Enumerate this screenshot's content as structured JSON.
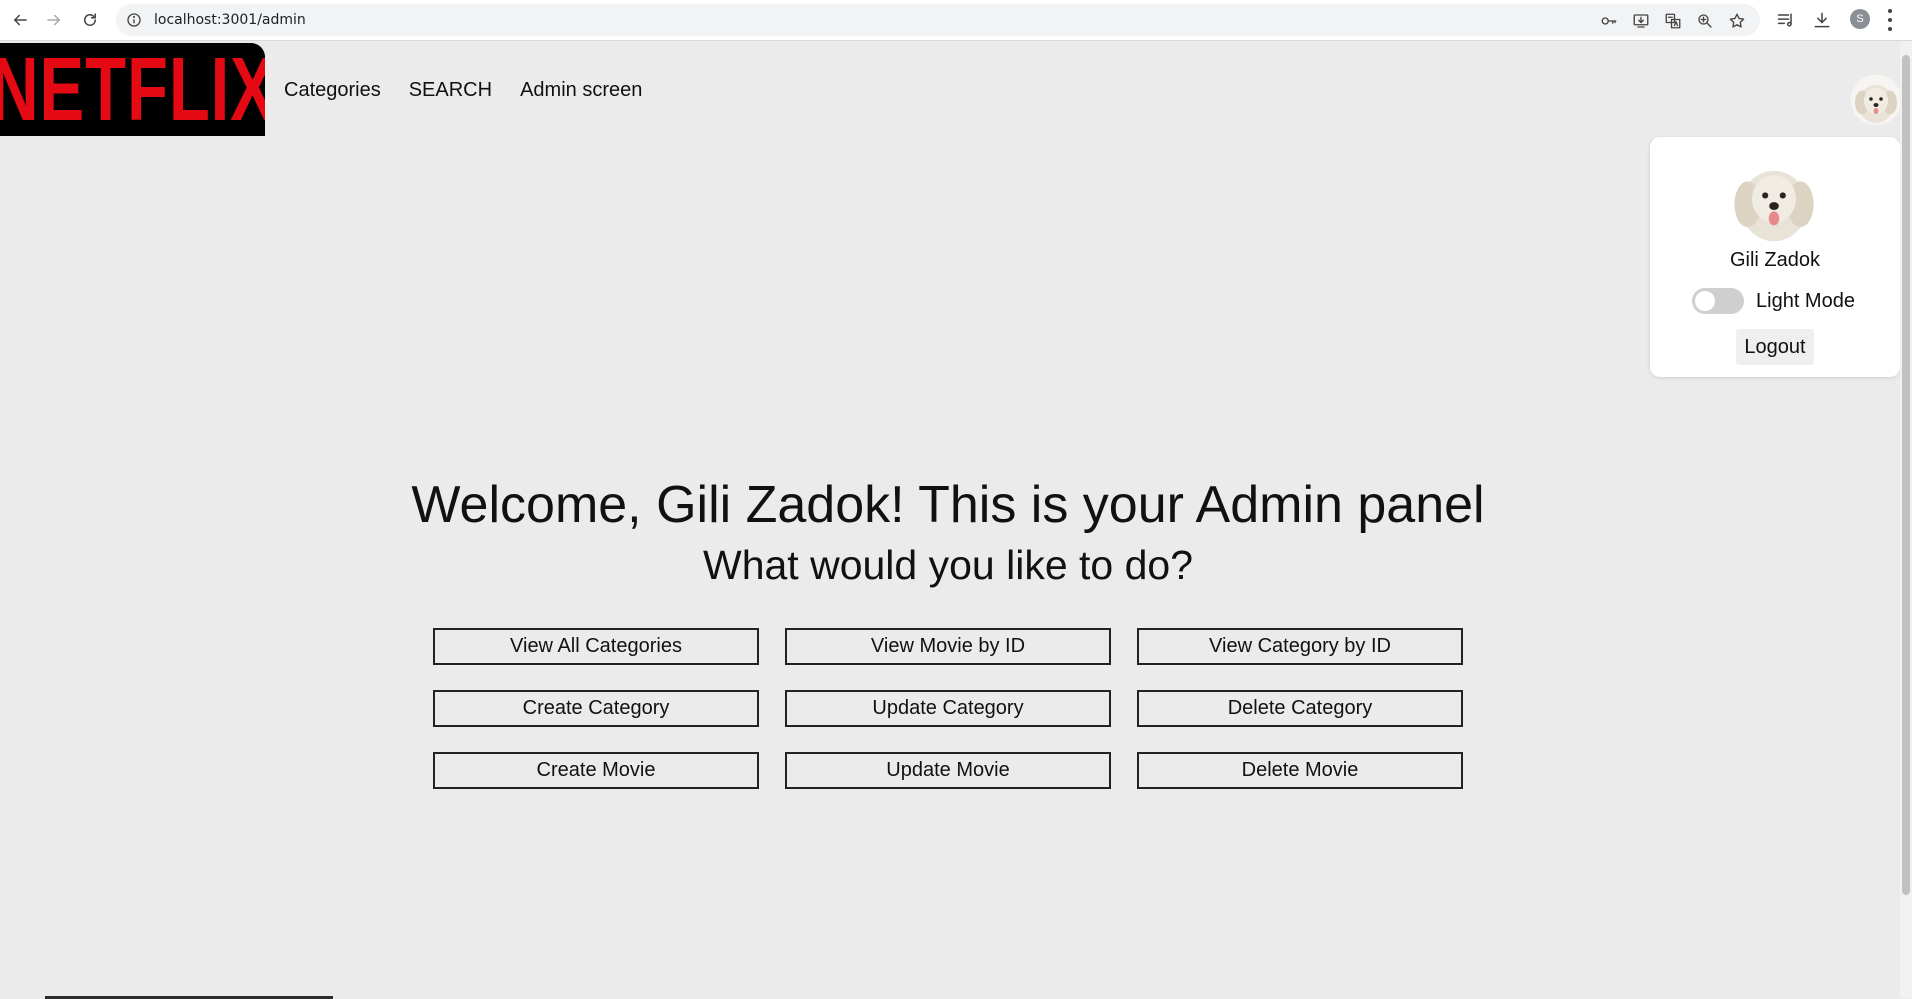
{
  "browser": {
    "url": "localhost:3001/admin",
    "profile_initial": "S"
  },
  "header": {
    "logo_text": "NETFLIX",
    "nav": [
      {
        "label": "Categories"
      },
      {
        "label": "SEARCH"
      },
      {
        "label": "Admin screen"
      }
    ]
  },
  "profile_menu": {
    "name": "Gili Zadok",
    "mode_label": "Light Mode",
    "logout_label": "Logout"
  },
  "main": {
    "welcome": "Welcome, Gili Zadok! This is your Admin panel",
    "question": "What would you like to do?",
    "actions": [
      {
        "label": "View All Categories"
      },
      {
        "label": "View Movie by ID"
      },
      {
        "label": "View Category by ID"
      },
      {
        "label": "Create Category"
      },
      {
        "label": "Update Category"
      },
      {
        "label": "Delete Category"
      },
      {
        "label": "Create Movie"
      },
      {
        "label": "Update Movie"
      },
      {
        "label": "Delete Movie"
      }
    ]
  },
  "colors": {
    "page_bg": "#ebebeb",
    "brand_red": "#e50914",
    "logo_bg": "#000000"
  }
}
